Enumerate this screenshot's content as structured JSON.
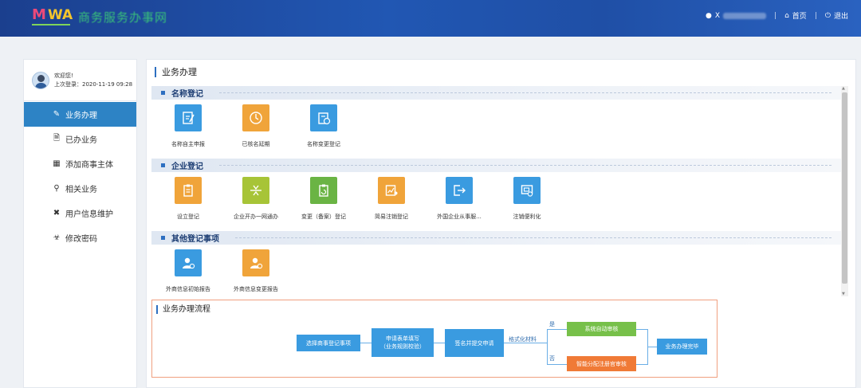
{
  "header": {
    "logo_text": "MWA",
    "site_title": "商务服务办事网",
    "user_initial": "X",
    "home_label": "首页",
    "logout_label": "退出",
    "divider": "|"
  },
  "sidebar": {
    "greeting": "欢迎您!",
    "last_login": "上次登录：2020-11-19 09:28",
    "items": [
      {
        "label": "业务办理",
        "icon": "edit-icon",
        "active": true
      },
      {
        "label": "已办业务",
        "icon": "document-done-icon",
        "active": false
      },
      {
        "label": "添加商事主体",
        "icon": "building-icon",
        "active": false
      },
      {
        "label": "相关业务",
        "icon": "search-doc-icon",
        "active": false
      },
      {
        "label": "用户信息维护",
        "icon": "tools-icon",
        "active": false
      },
      {
        "label": "修改密码",
        "icon": "lock-icon",
        "active": false
      }
    ]
  },
  "main": {
    "title": "业务办理",
    "sections": [
      {
        "title": "名称登记",
        "tiles": [
          {
            "label": "名称自主申报",
            "color": "#3a9be0",
            "icon": "edit-doc-icon"
          },
          {
            "label": "已核名延期",
            "color": "#f0a43a",
            "icon": "clock-icon"
          },
          {
            "label": "名称变更登记",
            "color": "#3a9be0",
            "icon": "doc-change-icon"
          }
        ]
      },
      {
        "title": "企业登记",
        "tiles": [
          {
            "label": "设立登记",
            "color": "#f0a43a",
            "icon": "clipboard-icon"
          },
          {
            "label": "企业开办一网通办",
            "color": "#a7c437",
            "icon": "merge-icon"
          },
          {
            "label": "变更（备案）登记",
            "color": "#6ab444",
            "icon": "clipboard-refresh-icon"
          },
          {
            "label": "简易注销登记",
            "color": "#f0a43a",
            "icon": "chart-doc-icon"
          },
          {
            "label": "外国企业从事服...",
            "color": "#3a9be0",
            "icon": "export-icon"
          },
          {
            "label": "注销便利化",
            "color": "#3a9be0",
            "icon": "cancel-doc-icon"
          }
        ]
      },
      {
        "title": "其他登记事项",
        "tiles": [
          {
            "label": "外商信息初始报告",
            "color": "#3a9be0",
            "icon": "person-doc-icon"
          },
          {
            "label": "外商信息变更报告",
            "color": "#f0a43a",
            "icon": "person-change-icon"
          }
        ]
      }
    ],
    "flow": {
      "title": "业务办理流程",
      "step1": "选择商事登记事项",
      "step2a": "申请表单填写",
      "step2b": "（业务规则校验）",
      "step3": "签名并提交申请",
      "formatted": "格式化材料",
      "yes": "是",
      "no": "否",
      "auto_review": "系统自动审核",
      "manual_review": "智能分配注册官审核",
      "done": "业务办理完毕"
    }
  },
  "colors": {
    "header": "#2157b3",
    "active_nav": "#2d83c5",
    "tile_blue": "#3a9be0",
    "tile_orange": "#f0a43a",
    "tile_lime": "#a7c437",
    "tile_green": "#6ab444",
    "flow_green": "#77c04a",
    "flow_orange": "#f07a36"
  }
}
